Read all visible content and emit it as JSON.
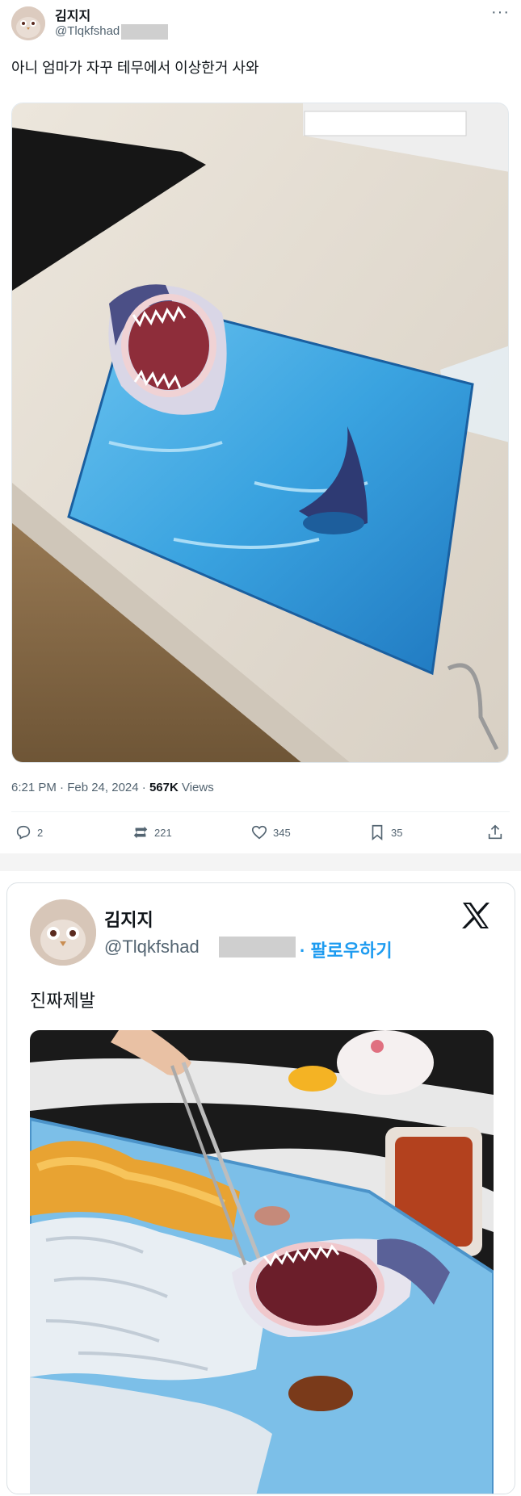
{
  "tweet1": {
    "author_name": "김지지",
    "author_handle": "@Tlqkfshad",
    "more": "···",
    "text": "아니 엄마가 자꾸 테무에서 이상한거 사와",
    "time": "6:21 PM · Feb 24, 2024 · ",
    "views_count": "567K",
    "views_label": " Views",
    "replies": "2",
    "reposts": "221",
    "likes": "345",
    "bookmarks": "35"
  },
  "tweet2": {
    "author_name": "김지지",
    "author_handle": "@Tlqkfshad",
    "follow_label": "· 팔로우하기",
    "text": "진짜제발"
  },
  "colors": {
    "accent": "#1d9bf0",
    "muted": "#536471",
    "text": "#0f1419",
    "tray_blue": "#3aa3e0"
  }
}
